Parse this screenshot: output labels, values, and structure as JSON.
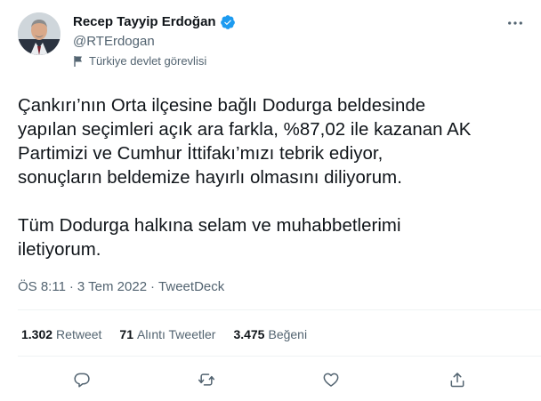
{
  "author": {
    "display_name": "Recep Tayyip Erdoğan",
    "handle": "@RTErdogan",
    "label": "Türkiye devlet görevlisi",
    "verified_color": "#1d9bf0"
  },
  "tweet": {
    "paragraphs": [
      "Çankırı’nın Orta ilçesine bağlı Dodurga beldesinde\nyapılan seçimleri açık ara farkla, %87,02 ile kazanan AK\nPartimizi ve Cumhur İttifakı’mızı tebrik ediyor,\nsonuçların beldemize hayırlı olmasını diliyorum.",
      "Tüm Dodurga halkına selam ve muhabbetlerimi\niletiyorum."
    ],
    "time": "ÖS 8:11",
    "date": "3 Tem 2022",
    "source": "TweetDeck",
    "separator": "·"
  },
  "stats": {
    "retweets_value": "1.302",
    "retweets_label": "Retweet",
    "quotes_value": "71",
    "quotes_label": "Alıntı Tweetler",
    "likes_value": "3.475",
    "likes_label": "Beğeni"
  },
  "icons": {
    "more": "more-horizontal-icon",
    "label": "flag-icon",
    "reply": "reply-icon",
    "retweet": "retweet-icon",
    "like": "heart-icon",
    "share": "share-icon"
  },
  "colors": {
    "text_primary": "#0f1419",
    "text_secondary": "#536471",
    "divider": "#eff3f4"
  }
}
